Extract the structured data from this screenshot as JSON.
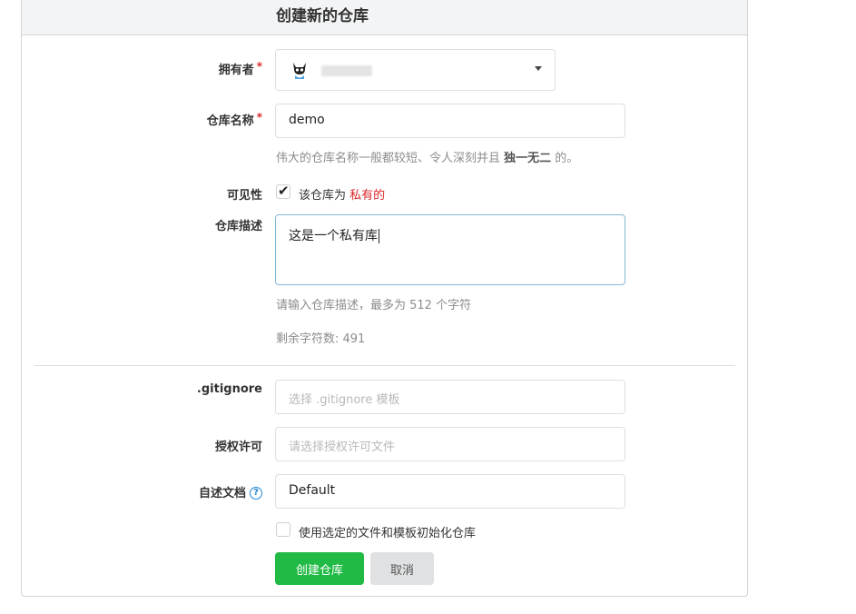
{
  "header": {
    "title": "创建新的仓库"
  },
  "owner": {
    "label": "拥有者",
    "required_mark": "*",
    "avatar_icon": "github-octocat-avatar"
  },
  "repo_name": {
    "label": "仓库名称",
    "required_mark": "*",
    "value": "demo",
    "hint_prefix": "伟大的仓库名称一般都较短、令人深刻并且 ",
    "hint_emphasis": "独一无二",
    "hint_suffix": " 的。"
  },
  "visibility": {
    "label": "可见性",
    "checked": true,
    "text_prefix": "该仓库为 ",
    "text_highlight": "私有的"
  },
  "description": {
    "label": "仓库描述",
    "value": "这是一个私有库",
    "hint": "请输入仓库描述，最多为 512 个字符",
    "remaining": "剩余字符数: 491"
  },
  "gitignore": {
    "label": ".gitignore",
    "placeholder": "选择 .gitignore 模板"
  },
  "license": {
    "label": "授权许可",
    "placeholder": "请选择授权许可文件"
  },
  "readme": {
    "label": "自述文档",
    "value": "Default",
    "help_icon": "question-circle-icon"
  },
  "auto_init": {
    "checked": false,
    "label": "使用选定的文件和模板初始化仓库"
  },
  "buttons": {
    "create": "创建仓库",
    "cancel": "取消"
  },
  "colors": {
    "primary": "#21ba45",
    "danger": "#db2828",
    "focus": "#85b7d9",
    "help": "#2185d0"
  }
}
